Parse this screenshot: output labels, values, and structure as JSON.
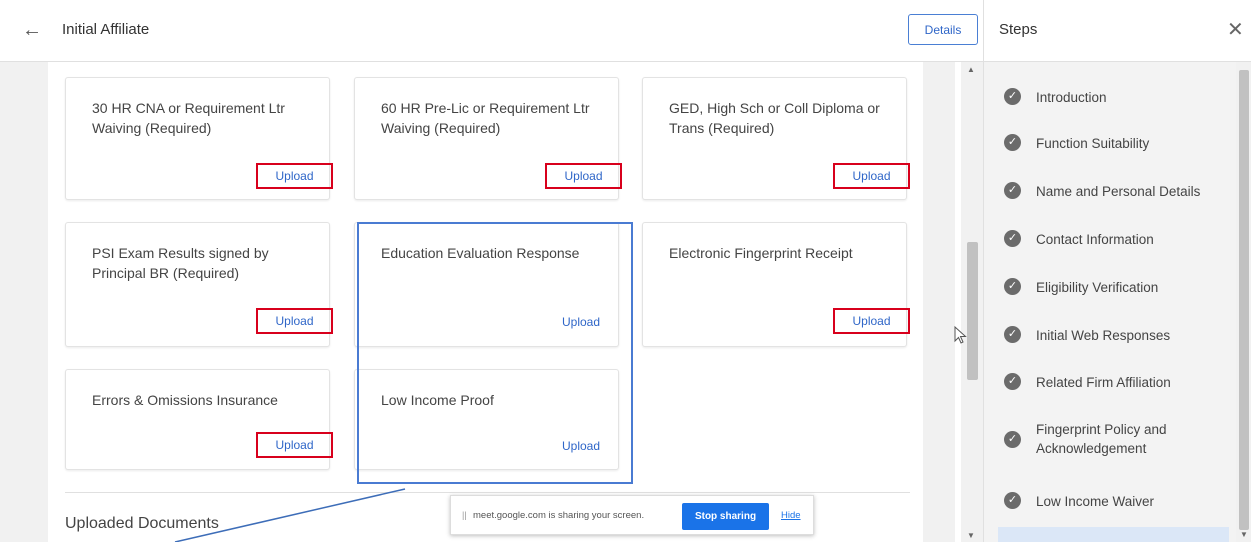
{
  "header": {
    "back_icon": "arrow-left-icon",
    "title": "Initial Affiliate",
    "details_label": "Details"
  },
  "cards": [
    {
      "title": "30 HR CNA or Requirement Ltr Waiving (Required)",
      "action": "Upload"
    },
    {
      "title": "60 HR Pre-Lic or Requirement Ltr Waiving (Required)",
      "action": "Upload"
    },
    {
      "title": "GED, High Sch or Coll Diploma or Trans (Required)",
      "action": "Upload"
    },
    {
      "title": "PSI Exam Results signed by Principal BR (Required)",
      "action": "Upload"
    },
    {
      "title": "Education Evaluation Response",
      "action": "Upload"
    },
    {
      "title": "Electronic Fingerprint Receipt",
      "action": "Upload"
    },
    {
      "title": "Errors & Omissions Insurance",
      "action": "Upload"
    },
    {
      "title": "Low Income Proof",
      "action": "Upload"
    }
  ],
  "uploaded_heading": "Uploaded Documents",
  "steps": {
    "title": "Steps",
    "close_icon": "close-icon",
    "items": [
      {
        "label": "Introduction"
      },
      {
        "label": "Function Suitability"
      },
      {
        "label": "Name and Personal Details"
      },
      {
        "label": "Contact Information"
      },
      {
        "label": "Eligibility Verification"
      },
      {
        "label": "Initial Web Responses"
      },
      {
        "label": "Related Firm Affiliation"
      },
      {
        "label": "Fingerprint Policy and Acknowledgement"
      },
      {
        "label": "Low Income Waiver"
      }
    ]
  },
  "screen_share": {
    "grip": "||",
    "message": "meet.google.com is sharing your screen.",
    "stop_label": "Stop sharing",
    "hide_label": "Hide"
  },
  "colors": {
    "link": "#2f66c8",
    "highlight_box": "#d8001c",
    "group_box": "#4a7bd2",
    "share_button": "#1a73e8"
  }
}
